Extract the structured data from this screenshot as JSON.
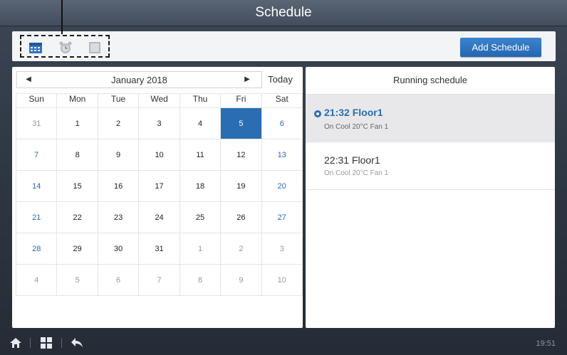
{
  "header": {
    "title": "Schedule"
  },
  "toolbar": {
    "icons": [
      "calendar-icon",
      "alarm-clock-icon",
      "list-icon"
    ],
    "add_button_label": "Add Schedule"
  },
  "calendar": {
    "month_label": "January  2018",
    "today_label": "Today",
    "prev_symbol": "◀",
    "next_symbol": "▶",
    "weekdays": [
      "Sun",
      "Mon",
      "Tue",
      "Wed",
      "Thu",
      "Fri",
      "Sat"
    ],
    "weeks": [
      [
        "31",
        "1",
        "2",
        "3",
        "4",
        "5",
        "6"
      ],
      [
        "7",
        "8",
        "9",
        "10",
        "11",
        "12",
        "13"
      ],
      [
        "14",
        "15",
        "16",
        "17",
        "18",
        "19",
        "20"
      ],
      [
        "21",
        "22",
        "23",
        "24",
        "25",
        "26",
        "27"
      ],
      [
        "28",
        "29",
        "30",
        "31",
        "1",
        "2",
        "3"
      ],
      [
        "4",
        "5",
        "6",
        "7",
        "8",
        "9",
        "10"
      ]
    ],
    "selected_day": "5"
  },
  "schedule": {
    "title": "Running schedule",
    "items": [
      {
        "time_label": "21:32 Floor1",
        "detail": "On Cool 20°C Fan 1",
        "running": true
      },
      {
        "time_label": "22:31 Floor1",
        "detail": "On Cool 20°C Fan 1",
        "running": false
      }
    ]
  },
  "bottom_bar": {
    "icons": [
      "home-icon",
      "grid-icon",
      "back-icon"
    ],
    "clock": "19:51"
  },
  "colors": {
    "accent": "#2b6db3",
    "header_bg": "#4d5767"
  }
}
